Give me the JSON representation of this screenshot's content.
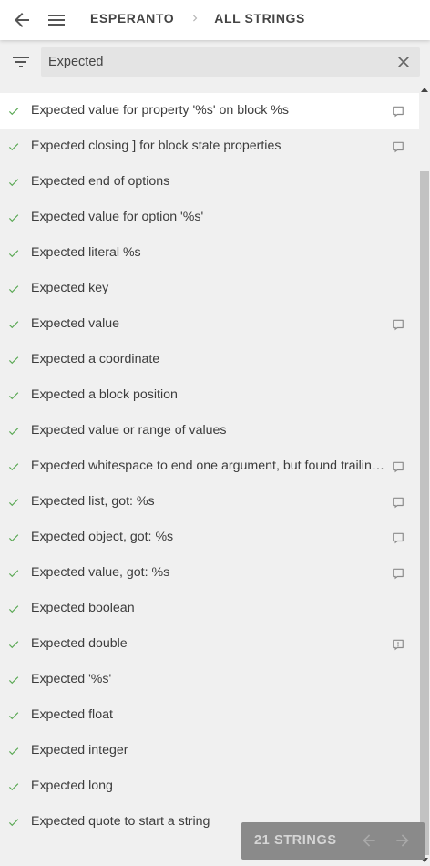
{
  "header": {
    "breadcrumbs": [
      "ESPERANTO",
      "ALL STRINGS"
    ]
  },
  "filter": {
    "value": "Expected",
    "placeholder": ""
  },
  "strings": [
    {
      "text": "Expected value for property '%s' on block %s",
      "comment": "comment"
    },
    {
      "text": "Expected closing ] for block state properties",
      "comment": "comment"
    },
    {
      "text": "Expected end of options",
      "comment": ""
    },
    {
      "text": "Expected value for option '%s'",
      "comment": ""
    },
    {
      "text": "Expected literal %s",
      "comment": ""
    },
    {
      "text": "Expected key",
      "comment": ""
    },
    {
      "text": "Expected value",
      "comment": "comment"
    },
    {
      "text": "Expected a coordinate",
      "comment": ""
    },
    {
      "text": "Expected a block position",
      "comment": ""
    },
    {
      "text": "Expected value or range of values",
      "comment": ""
    },
    {
      "text": "Expected whitespace to end one argument, but found trailing data",
      "comment": "comment"
    },
    {
      "text": "Expected list, got: %s",
      "comment": "comment"
    },
    {
      "text": "Expected object, got: %s",
      "comment": "comment"
    },
    {
      "text": "Expected value, got: %s",
      "comment": "comment"
    },
    {
      "text": "Expected boolean",
      "comment": ""
    },
    {
      "text": "Expected double",
      "comment": "issue"
    },
    {
      "text": "Expected '%s'",
      "comment": ""
    },
    {
      "text": "Expected float",
      "comment": ""
    },
    {
      "text": "Expected integer",
      "comment": ""
    },
    {
      "text": "Expected long",
      "comment": ""
    },
    {
      "text": "Expected quote to start a string",
      "comment": ""
    }
  ],
  "pager": {
    "count_label": "21 STRINGS"
  },
  "colors": {
    "check": "#5aa854",
    "icon": "#8a8a8a"
  }
}
